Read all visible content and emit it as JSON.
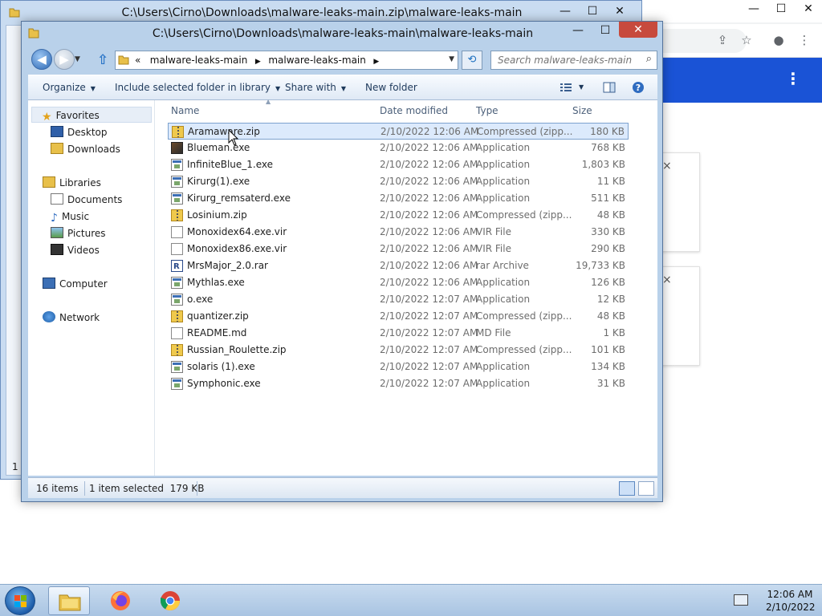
{
  "background_window": {
    "title": "C:\\Users\\Cirno\\Downloads\\malware-leaks-main.zip\\malware-leaks-main",
    "status_fragment": "1"
  },
  "caption_buttons": {
    "minimize": "—",
    "maximize": "☐",
    "close": "✕"
  },
  "window": {
    "title": "C:\\Users\\Cirno\\Downloads\\malware-leaks-main\\malware-leaks-main",
    "address": {
      "chevron": "«",
      "crumbs": [
        "malware-leaks-main",
        "malware-leaks-main"
      ]
    },
    "search": {
      "placeholder": "Search malware-leaks-main"
    },
    "commands": {
      "organize": "Organize",
      "include_library": "Include selected folder in library",
      "share_with": "Share with",
      "new_folder": "New folder"
    },
    "nav_pane": {
      "favorites": "Favorites",
      "desktop": "Desktop",
      "downloads": "Downloads",
      "libraries": "Libraries",
      "documents": "Documents",
      "music": "Music",
      "pictures": "Pictures",
      "videos": "Videos",
      "computer": "Computer",
      "network": "Network"
    },
    "columns": {
      "name": "Name",
      "date": "Date modified",
      "type": "Type",
      "size": "Size"
    },
    "files": [
      {
        "name": "Aramaware.zip",
        "date": "2/10/2022 12:06 AM",
        "type": "Compressed (zipp...",
        "size": "180 KB",
        "icon": "zip-folder-icon"
      },
      {
        "name": "Blueman.exe",
        "date": "2/10/2022 12:06 AM",
        "type": "Application",
        "size": "768 KB",
        "icon": "app-icon"
      },
      {
        "name": "InfiniteBlue_1.exe",
        "date": "2/10/2022 12:06 AM",
        "type": "Application",
        "size": "1,803 KB",
        "icon": "exe-icon"
      },
      {
        "name": "Kirurg(1).exe",
        "date": "2/10/2022 12:06 AM",
        "type": "Application",
        "size": "11 KB",
        "icon": "exe-icon"
      },
      {
        "name": "Kirurg_remsaterd.exe",
        "date": "2/10/2022 12:06 AM",
        "type": "Application",
        "size": "511 KB",
        "icon": "exe-icon"
      },
      {
        "name": "Losinium.zip",
        "date": "2/10/2022 12:06 AM",
        "type": "Compressed (zipp...",
        "size": "48 KB",
        "icon": "zip-folder-icon"
      },
      {
        "name": "Monoxidex64.exe.vir",
        "date": "2/10/2022 12:06 AM",
        "type": "VIR File",
        "size": "330 KB",
        "icon": "file-icon"
      },
      {
        "name": "Monoxidex86.exe.vir",
        "date": "2/10/2022 12:06 AM",
        "type": "VIR File",
        "size": "290 KB",
        "icon": "file-icon"
      },
      {
        "name": "MrsMajor_2.0.rar",
        "date": "2/10/2022 12:06 AM",
        "type": "rar Archive",
        "size": "19,733 KB",
        "icon": "rar-icon"
      },
      {
        "name": "Mythlas.exe",
        "date": "2/10/2022 12:06 AM",
        "type": "Application",
        "size": "126 KB",
        "icon": "exe-icon"
      },
      {
        "name": "o.exe",
        "date": "2/10/2022 12:07 AM",
        "type": "Application",
        "size": "12 KB",
        "icon": "exe-icon"
      },
      {
        "name": "quantizer.zip",
        "date": "2/10/2022 12:07 AM",
        "type": "Compressed (zipp...",
        "size": "48 KB",
        "icon": "zip-folder-icon"
      },
      {
        "name": "README.md",
        "date": "2/10/2022 12:07 AM",
        "type": "MD File",
        "size": "1 KB",
        "icon": "file-icon"
      },
      {
        "name": "Russian_Roulette.zip",
        "date": "2/10/2022 12:07 AM",
        "type": "Compressed (zipp...",
        "size": "101 KB",
        "icon": "zip-folder-icon"
      },
      {
        "name": "solaris (1).exe",
        "date": "2/10/2022 12:07 AM",
        "type": "Application",
        "size": "134 KB",
        "icon": "exe-icon"
      },
      {
        "name": "Symphonic.exe",
        "date": "2/10/2022 12:07 AM",
        "type": "Application",
        "size": "31 KB",
        "icon": "exe-icon"
      }
    ],
    "selected_index": 0,
    "status": {
      "items": "16 items",
      "selected": "1 item selected  179 KB"
    }
  },
  "chrome": {
    "menu_glyph": "⋮",
    "card_close": "×"
  },
  "taskbar": {
    "apps": [
      "windows-explorer-icon",
      "firefox-icon",
      "chrome-icon"
    ],
    "clock": {
      "time": "12:06 AM",
      "date": "2/10/2022"
    }
  },
  "colors": {
    "selection": "#dceafc",
    "close_button": "#c74a3d",
    "chrome_blue": "#1a53d6"
  }
}
